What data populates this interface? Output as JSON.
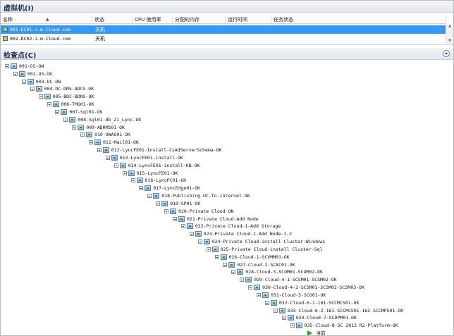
{
  "vm_section": {
    "title": "虚拟机(I)",
    "columns": [
      "名称",
      "状态",
      "CPU 使用率",
      "分配的内存",
      "运行时间",
      "任务状态"
    ],
    "rows": [
      {
        "name": "001-DC01.i-m-Cloud.com",
        "status": "关机",
        "selected": true
      },
      {
        "name": "002-DC02.i-m-Cloud.com",
        "status": "关机",
        "selected": false
      }
    ]
  },
  "checkpoint_section": {
    "title": "检查点(C)",
    "nodes": [
      "001-OS-ON",
      "002-OS-OK",
      "003-UC-ON",
      "004-DC-DNS-ADCS-OK",
      "005-BDC-BDNS-OK",
      "006-TMG01-OK",
      "007-Sql01-OK",
      "008-Sql01-db_21_Lync-OK",
      "009-ADRMS01-OK",
      "010-OWAS01-OK",
      "011-Mail01-OK",
      "012-LyncFE01-Install-CsAdServerSchema-OK",
      "013-LyncFE01-install-OK",
      "014-LyncFE01-install-KB-OK",
      "015-LyncFE01-OK",
      "016-LyncPC01-OK",
      "017-LyncEdge01-OK",
      "018-Publishing-UC-To-internet-OK",
      "019-SP01-OK",
      "020-Private Cloud ON",
      "021-Private Cloud-Add Node",
      "022-Private Cloud-1-Add Storage",
      "023-Private Cloud-1-Add Node-1-2",
      "024-Private Cloud-install Cluster-Windows",
      "025-Private Cloud-install Cluster-Sql",
      "026-Cloud-1-SCVMM01-OK",
      "027-Cloud-2-SCAC01-OK",
      "028-Cloud-3-SCOM01-SCOM02-OK",
      "029-Cloud-4-1-SCSM01-SCSM02-OK",
      "030-Cloud-4-2-SCSM01-SCSM02-SCSM03-OK",
      "031-Cloud-5-SCO01-OK",
      "032-Cloud-6-1-161-SCCMCS01-OK",
      "033-Cloud-6-2-161-SCCMCS01-162-SCCMPS01-OK",
      "034-Cloud-7-SCDPM01-OK",
      "035-Cloud-8-SC 2012 R2-Platform-OK"
    ],
    "now_label": "当前"
  }
}
